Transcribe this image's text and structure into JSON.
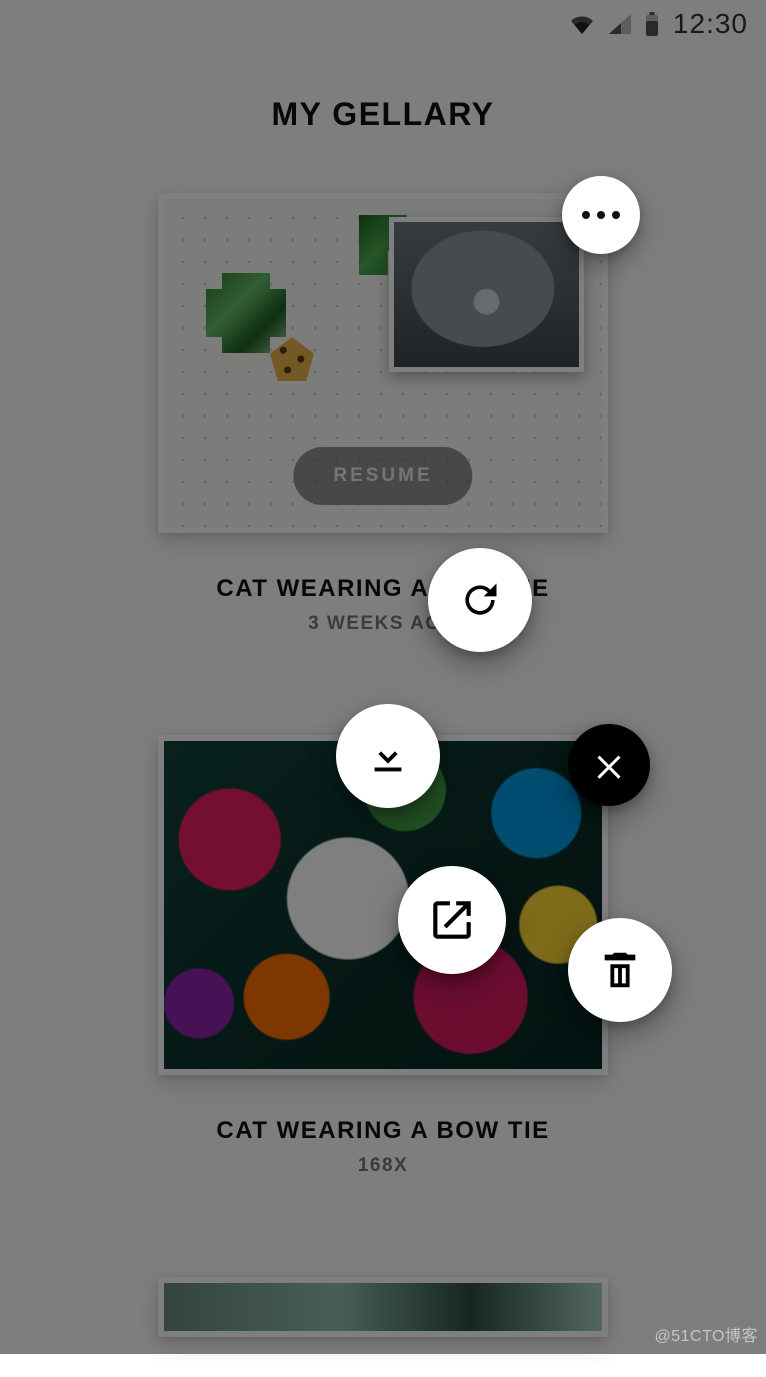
{
  "status_bar": {
    "time": "12:30",
    "icons": {
      "wifi": "wifi-icon",
      "cell": "cell-icon",
      "battery": "battery-icon"
    }
  },
  "header": {
    "title": "MY GELLARY"
  },
  "gallery": {
    "items": [
      {
        "title": "CAT WEARING A BOW TIE",
        "subtitle": "3 WEEKS AGO",
        "resume_label": "RESUME"
      },
      {
        "title": "CAT WEARING A BOW TIE",
        "subtitle": "168X"
      },
      {
        "title": "",
        "subtitle": ""
      }
    ]
  },
  "fab_menu": {
    "refresh": "refresh",
    "download": "download",
    "open": "open-in-new",
    "close": "close",
    "delete": "delete"
  },
  "watermark": "@51CTO博客"
}
